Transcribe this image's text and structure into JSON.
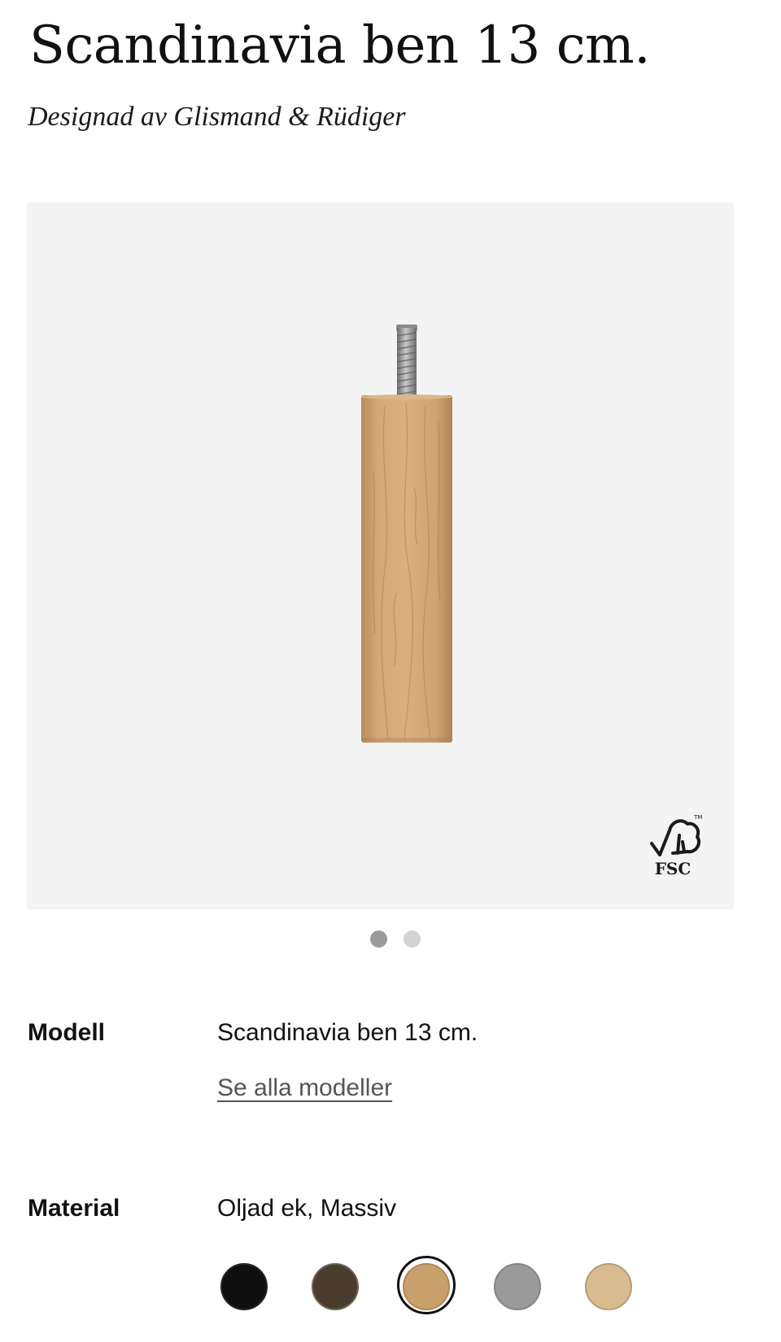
{
  "product": {
    "title": "Scandinavia ben 13 cm.",
    "designer": "Designad av Glismand & Rüdiger"
  },
  "gallery": {
    "image_icon": "wooden-leg-image",
    "certification_badge": "FSC",
    "slides_total": 2,
    "active_slide": 1
  },
  "options": {
    "model": {
      "label": "Modell",
      "value": "Scandinavia ben 13 cm.",
      "link_text": "Se alla modeller"
    },
    "material": {
      "label": "Material",
      "value": "Oljad ek, Massiv",
      "selected_index": 2,
      "swatches": [
        {
          "color": "#0f0f0f",
          "border": "#262626"
        },
        {
          "color": "#4a3d2e",
          "border": "#6f6658"
        },
        {
          "color": "#c8a06c",
          "border": "#b08855"
        },
        {
          "color": "#9a9a9a",
          "border": "#858585"
        },
        {
          "color": "#d8bc90",
          "border": "#b79c74"
        }
      ]
    }
  },
  "colors": {
    "gallery_background": "#f4f4f4",
    "text": "#111111",
    "link": "#555555",
    "dot_active": "#9a9a9a",
    "dot_inactive": "#d3d3d3"
  }
}
